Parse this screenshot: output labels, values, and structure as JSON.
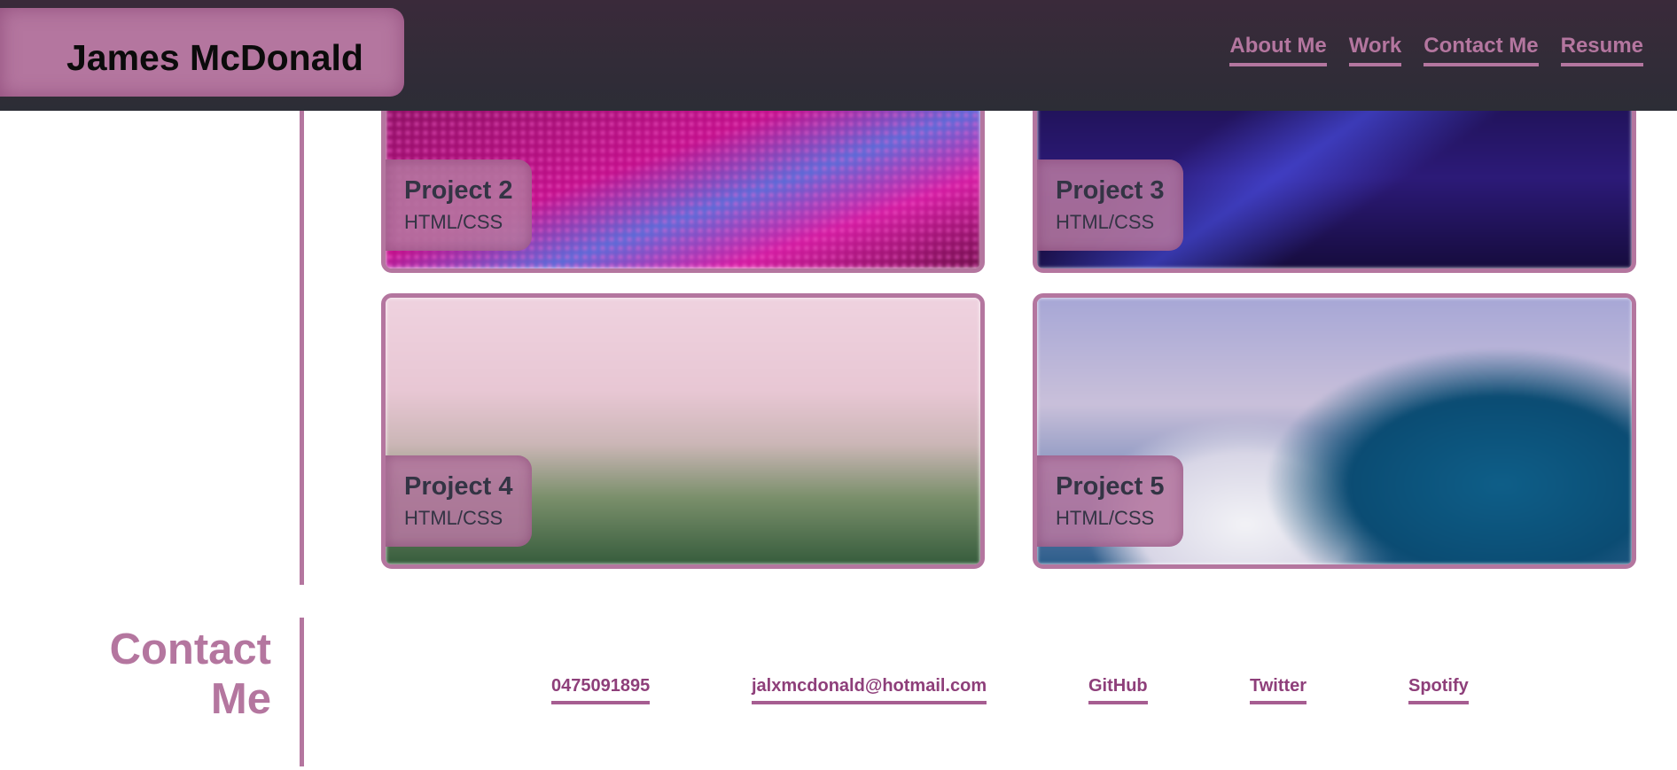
{
  "header": {
    "brand_name": "James McDonald",
    "nav": [
      "About Me",
      "Work",
      "Contact Me",
      "Resume"
    ]
  },
  "projects": [
    {
      "title": "Project 2",
      "tech": "HTML/CSS"
    },
    {
      "title": "Project 3",
      "tech": "HTML/CSS"
    },
    {
      "title": "Project 4",
      "tech": "HTML/CSS"
    },
    {
      "title": "Project 5",
      "tech": "HTML/CSS"
    }
  ],
  "contact": {
    "heading_line1": "Contact",
    "heading_line2": "Me",
    "links": [
      "0475091895",
      "jalxmcdonald@hotmail.com",
      "GitHub",
      "Twitter",
      "Spotify"
    ]
  },
  "colors": {
    "accent": "#b4769f",
    "header_bg": "#2c2d36",
    "link_text": "#8e3f7a",
    "card_text": "#333444"
  }
}
